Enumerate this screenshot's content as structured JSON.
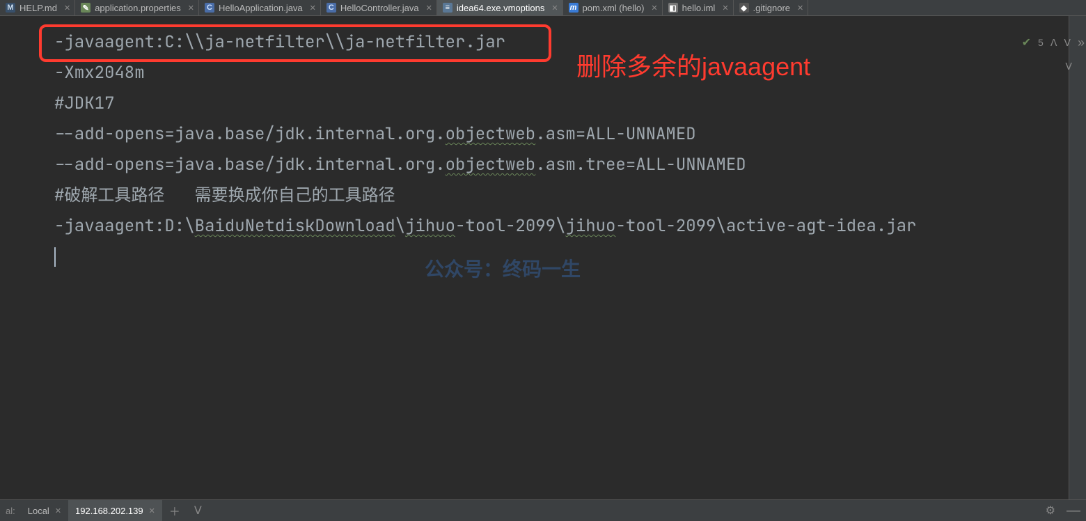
{
  "tabs": [
    {
      "icon": "md",
      "label": "HELP.md"
    },
    {
      "icon": "prop",
      "label": "application.properties"
    },
    {
      "icon": "java",
      "label": "HelloApplication.java"
    },
    {
      "icon": "java",
      "label": "HelloController.java"
    },
    {
      "icon": "txt",
      "label": "idea64.exe.vmoptions",
      "active": true
    },
    {
      "icon": "xml",
      "label": "pom.xml (hello)"
    },
    {
      "icon": "iml",
      "label": "hello.iml"
    },
    {
      "icon": "git",
      "label": ".gitignore"
    }
  ],
  "editor": {
    "lines": [
      "-javaagent:C:\\\\ja-netfilter\\\\ja-netfilter.jar",
      "-Xmx2048m",
      "#JDK17",
      "--add-opens=java.base/jdk.internal.org.objectweb.asm=ALL-UNNAMED",
      "--add-opens=java.base/jdk.internal.org.objectweb.asm.tree=ALL-UNNAMED",
      "",
      "#破解工具路径   需要换成你自己的工具路径",
      "-javaagent:D:\\BaiduNetdiskDownload\\jihuo-tool-2099\\jihuo-tool-2099\\active-agt-idea.jar"
    ],
    "warning_count": "5"
  },
  "annotation": {
    "label": "删除多余的javaagent"
  },
  "watermark": "公众号：终码一生",
  "bottom": {
    "prefix": "al:",
    "tabs": [
      {
        "label": "Local",
        "active": false
      },
      {
        "label": "192.168.202.139",
        "active": true
      }
    ]
  }
}
